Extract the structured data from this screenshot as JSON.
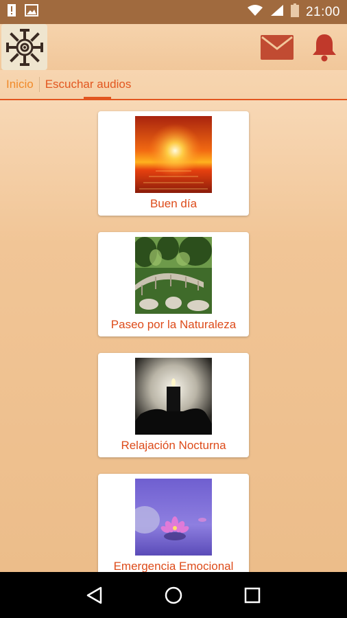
{
  "status_bar": {
    "time": "21:00",
    "icons": [
      "alert-icon",
      "image-icon",
      "wifi-icon",
      "signal-icon",
      "battery-icon"
    ]
  },
  "header": {
    "logo": "tribal-sun-logo",
    "actions": [
      "mail-icon",
      "bell-icon"
    ],
    "accent_color": "#c0392b"
  },
  "tabs": [
    {
      "label": "Inicio",
      "selected": false
    },
    {
      "label": "Escuchar audios",
      "selected": true
    }
  ],
  "audios": [
    {
      "title": "Buen día",
      "image": "sunset-over-water"
    },
    {
      "title": "Paseo por la Naturaleza",
      "image": "garden-bridge"
    },
    {
      "title": "Relajación Nocturna",
      "image": "candle-in-hand"
    },
    {
      "title": "Emergencia Emocional",
      "image": "lotus-flower"
    }
  ],
  "nav_bar": [
    "back-icon",
    "home-icon",
    "recents-icon"
  ],
  "colors": {
    "accent": "#e2561f",
    "text_accent": "#dd4b1a",
    "status_bar": "#a06a3e"
  }
}
